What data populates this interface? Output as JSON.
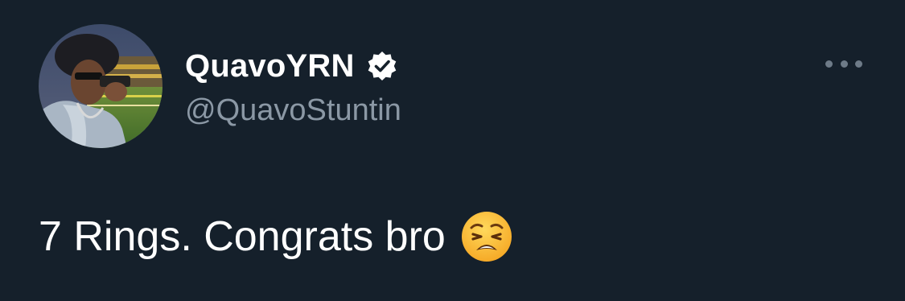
{
  "tweet": {
    "author": {
      "display_name": "QuavoYRN",
      "handle": "@QuavoStuntin",
      "verified": true,
      "avatar_icon": "profile-photo",
      "verified_icon": "verified-badge-icon"
    },
    "text": "7 Rings. Congrats bro",
    "emoji": "weary-face-emoji",
    "more_icon": "more-options-icon"
  },
  "colors": {
    "background": "#15202b",
    "primary_text": "#ffffff",
    "secondary_text": "#8b98a5",
    "icon_muted": "#6e7b88"
  }
}
